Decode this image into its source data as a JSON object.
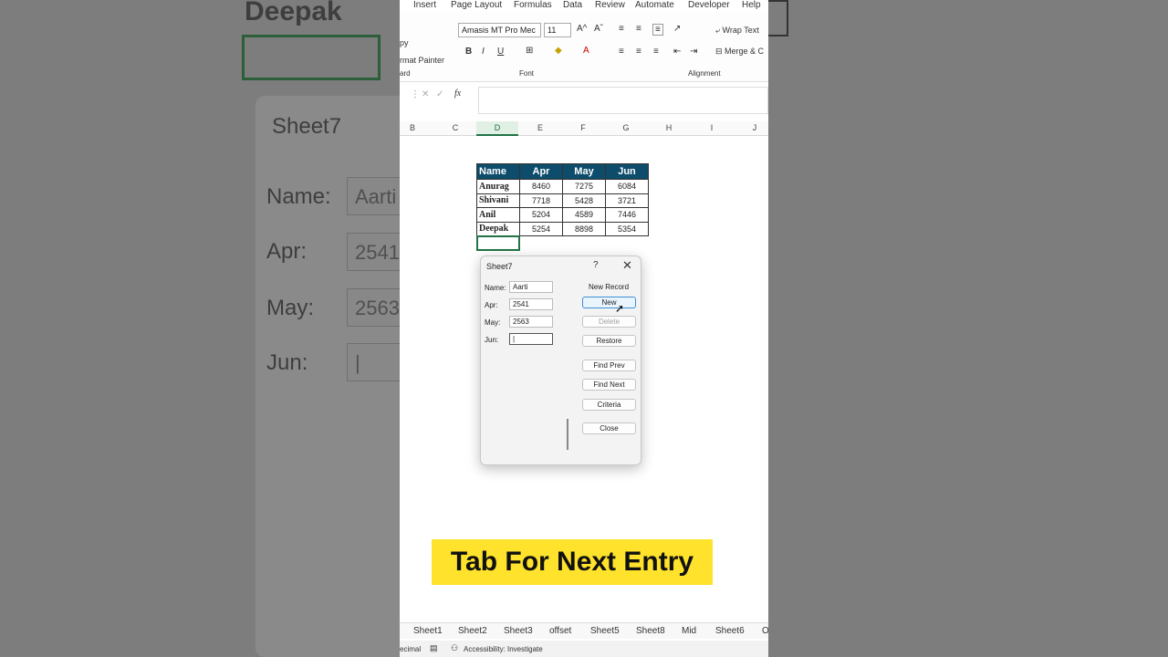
{
  "background": {
    "cell_text": "Deepak",
    "dialog_title": "Sheet7",
    "labels": [
      "Name:",
      "Apr:",
      "May:",
      "Jun:"
    ],
    "values": [
      "Aarti",
      "2541",
      "2563",
      "|"
    ]
  },
  "menu": [
    "Insert",
    "Page Layout",
    "Formulas",
    "Data",
    "Review",
    "Automate",
    "Developer",
    "Help"
  ],
  "ribbon": {
    "clipboard_copy": "py",
    "clipboard_painter": "rmat Painter",
    "clipboard_group": "ard",
    "font_name": "Amasis MT Pro Mec",
    "font_size": "11",
    "font_group": "Font",
    "wrap_text": "Wrap Text",
    "merge": "Merge & C",
    "alignment_group": "Alignment"
  },
  "formula": {
    "fx": "fx"
  },
  "columns": [
    "B",
    "C",
    "D",
    "E",
    "F",
    "G",
    "H",
    "I",
    "J"
  ],
  "table": {
    "headers": [
      "Name",
      "Apr",
      "May",
      "Jun"
    ],
    "rows": [
      [
        "Anurag",
        "8460",
        "7275",
        "6084"
      ],
      [
        "Shivani",
        "7718",
        "5428",
        "3721"
      ],
      [
        "Anil",
        "5204",
        "4589",
        "7446"
      ],
      [
        "Deepak",
        "5254",
        "8898",
        "5354"
      ]
    ]
  },
  "dialog": {
    "title": "Sheet7",
    "help": "?",
    "close_x": "✕",
    "record_label": "New Record",
    "fields": [
      {
        "label": "Name:",
        "value": "Aarti"
      },
      {
        "label": "Apr:",
        "value": "2541"
      },
      {
        "label": "May:",
        "value": "2563"
      },
      {
        "label": "Jun:",
        "value": "|"
      }
    ],
    "buttons": {
      "new": "New",
      "delete": "Delete",
      "restore": "Restore",
      "find_prev": "Find Prev",
      "find_next": "Find Next",
      "criteria": "Criteria",
      "close": "Close"
    }
  },
  "banner": "Tab For Next Entry",
  "sheet_tabs": [
    "Sheet1",
    "Sheet2",
    "Sheet3",
    "offset",
    "Sheet5",
    "Sheet8",
    "Mid",
    "Sheet6",
    "O"
  ],
  "status": {
    "left": "ecimal",
    "accessibility": "Accessibility: Investigate"
  },
  "colors": {
    "header_fill": "#0d4c6b",
    "banner": "#ffe22b",
    "accent": "#217346"
  }
}
